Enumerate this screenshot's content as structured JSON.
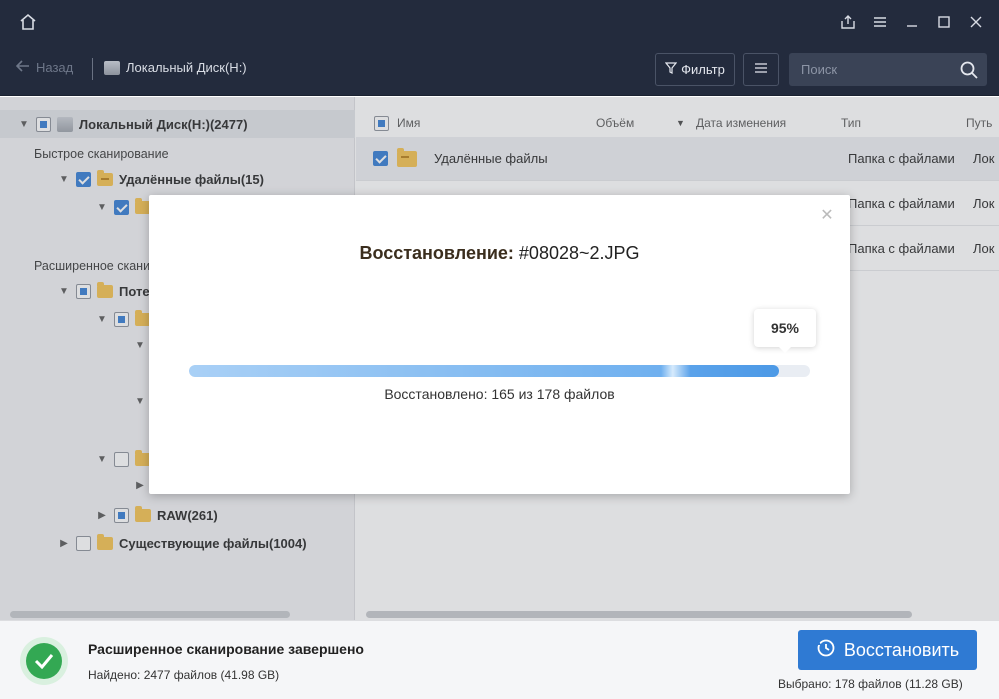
{
  "navigation": {
    "back_label": "Назад",
    "breadcrumb": "Локальный Диск(H:)",
    "filter_label": "Фильтр",
    "search_placeholder": "Поиск"
  },
  "tree": {
    "root": "Локальный Диск(H:)(2477)",
    "quick_scan_label": "Быстрое сканирование",
    "deleted_files": "Удалённые файлы(15)",
    "advanced_scan_label": "Расширенное скани",
    "lost_partial": "Поте",
    "raw": "RAW(261)",
    "existing_files": "Существующие файлы(1004)"
  },
  "file_list": {
    "columns": [
      "Имя",
      "Объём",
      "Дата изменения",
      "Тип",
      "Путь"
    ],
    "rows": [
      {
        "name": "Удалённые файлы",
        "type": "Папка с файлами",
        "path": "Лок"
      },
      {
        "name": "",
        "type": "Папка с файлами",
        "path": "Лок"
      },
      {
        "name": "",
        "type": "Папка с файлами",
        "path": "Лок"
      }
    ]
  },
  "status": {
    "title": "Расширенное сканирование завершено",
    "found": "Найдено: 2477 файлов (41.98 GB)",
    "recover_button": "Восстановить",
    "selected": "Выбрано: 178 файлов  (11.28 GB)"
  },
  "modal": {
    "title_prefix": "Восстановление:",
    "file_name": "#08028~2.JPG",
    "percent_label": "95%",
    "progress_fraction": 0.95,
    "progress_text": "Восстановлено: 165 из 178 файлов"
  },
  "colors": {
    "titlebar": "#232b3d",
    "accent": "#2f7ad3",
    "success": "#33a853"
  }
}
